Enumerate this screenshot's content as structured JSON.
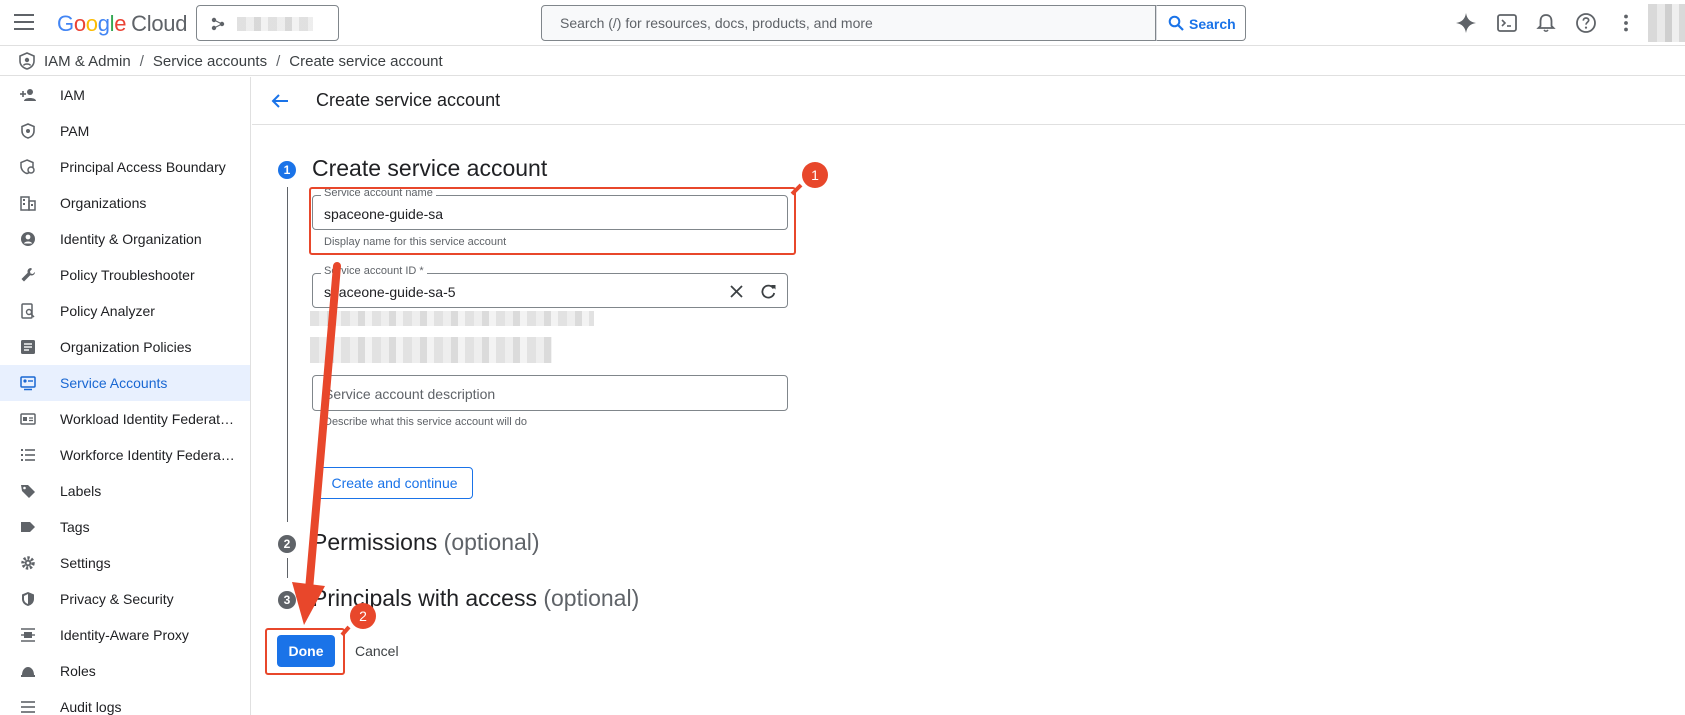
{
  "topbar": {
    "brand": "Google",
    "product": "Cloud",
    "search_placeholder": "Search (/) for resources, docs, products, and more",
    "search_button": "Search"
  },
  "breadcrumb": {
    "items": [
      "IAM & Admin",
      "Service accounts",
      "Create service account"
    ],
    "separator": "/"
  },
  "sidebar": {
    "items": [
      {
        "label": "IAM",
        "icon": "person-add-icon"
      },
      {
        "label": "PAM",
        "icon": "shield-icon"
      },
      {
        "label": "Principal Access Boundary",
        "icon": "policy-icon"
      },
      {
        "label": "Organizations",
        "icon": "building-icon"
      },
      {
        "label": "Identity & Organization",
        "icon": "account-circle-icon"
      },
      {
        "label": "Policy Troubleshooter",
        "icon": "wrench-icon"
      },
      {
        "label": "Policy Analyzer",
        "icon": "document-search-icon"
      },
      {
        "label": "Organization Policies",
        "icon": "list-document-icon"
      },
      {
        "label": "Service Accounts",
        "icon": "service-account-icon",
        "active": true
      },
      {
        "label": "Workload Identity Federat…",
        "icon": "badge-icon"
      },
      {
        "label": "Workforce Identity Federa…",
        "icon": "list-icon"
      },
      {
        "label": "Labels",
        "icon": "label-icon"
      },
      {
        "label": "Tags",
        "icon": "tag-icon"
      },
      {
        "label": "Settings",
        "icon": "gear-icon"
      },
      {
        "label": "Privacy & Security",
        "icon": "security-shield-icon"
      },
      {
        "label": "Identity-Aware Proxy",
        "icon": "proxy-icon"
      },
      {
        "label": "Roles",
        "icon": "roles-icon"
      },
      {
        "label": "Audit logs",
        "icon": "audit-icon"
      }
    ]
  },
  "main": {
    "title": "Create service account",
    "steps": [
      {
        "number": "1",
        "title": "Create service account",
        "optional": ""
      },
      {
        "number": "2",
        "title": "Permissions",
        "optional": "(optional)"
      },
      {
        "number": "3",
        "title": "Principals with access",
        "optional": "(optional)"
      }
    ],
    "name_field": {
      "label": "Service account name",
      "value": "spaceone-guide-sa",
      "hint": "Display name for this service account"
    },
    "id_field": {
      "label": "Service account ID *",
      "value": "spaceone-guide-sa-5"
    },
    "description_field": {
      "placeholder": "Service account description",
      "hint": "Describe what this service account will do"
    },
    "create_continue_button": "Create and continue",
    "done_button": "Done",
    "cancel_button": "Cancel"
  },
  "annotations": {
    "badge_1": "1",
    "badge_2": "2",
    "color": "#e8472b"
  },
  "colors": {
    "accent": "#1a73e8",
    "active_nav_bg": "#e8f0fe"
  }
}
